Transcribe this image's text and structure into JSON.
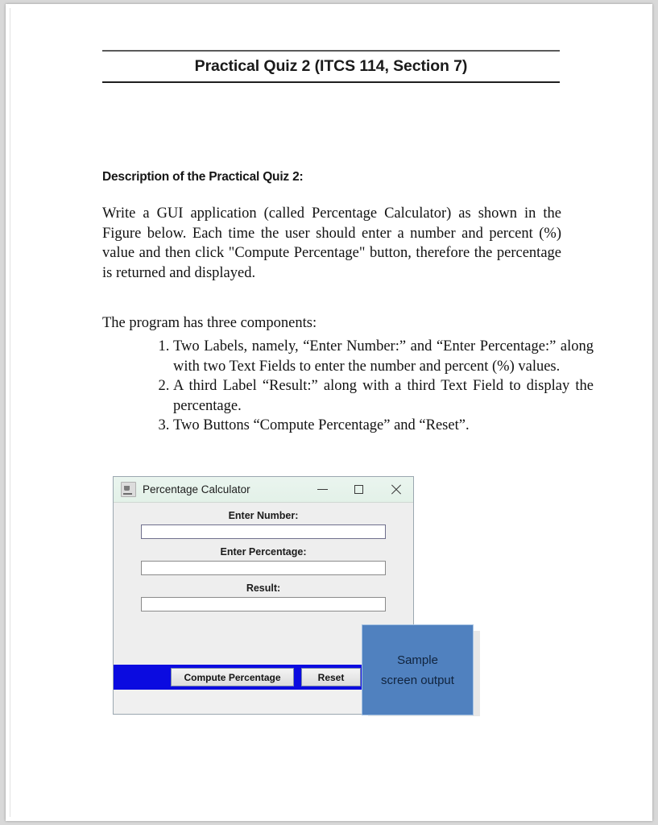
{
  "document": {
    "title": "Practical Quiz 2 (ITCS 114, Section 7)",
    "section_heading": "Description of the Practical Quiz 2:",
    "intro_paragraph": "Write a GUI application (called Percentage Calculator) as shown in the Figure below. Each time the user should enter a number and percent (%) value and then click \"Compute Percentage\" button, therefore the percentage is returned and displayed.",
    "components_intro": "The program has three components:",
    "components": [
      "Two Labels, namely, “Enter Number:” and “Enter Percentage:” along with two Text Fields to enter the number and percent (%) values.",
      "A third Label “Result:” along with a third Text Field to display the percentage.",
      "Two Buttons “Compute Percentage” and “Reset”."
    ]
  },
  "app_window": {
    "title": "Percentage Calculator",
    "icon": "java-app-icon",
    "controls": {
      "minimize": "minimize-icon",
      "maximize": "maximize-icon",
      "close": "close-icon"
    },
    "fields": [
      {
        "label": "Enter Number:",
        "value": "",
        "placeholder": ""
      },
      {
        "label": "Enter Percentage:",
        "value": "",
        "placeholder": ""
      },
      {
        "label": "Result:",
        "value": "",
        "placeholder": ""
      }
    ],
    "buttons": {
      "compute": "Compute Percentage",
      "reset": "Reset"
    },
    "colors": {
      "titlebar": "#e6f2ea",
      "body": "#eeeeee",
      "footer": "#0b0be0"
    }
  },
  "callout": {
    "line1": "Sample",
    "line2": "screen output",
    "color": "#5081bf"
  }
}
